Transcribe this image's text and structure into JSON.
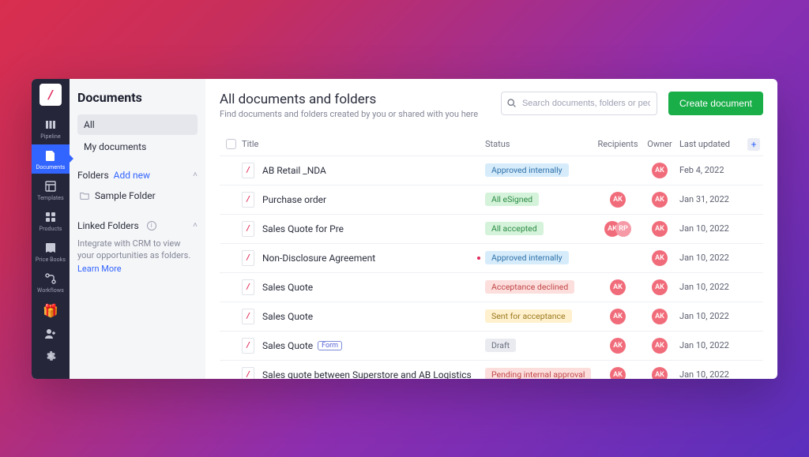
{
  "rail": {
    "items": [
      {
        "label": "Pipeline"
      },
      {
        "label": "Documents"
      },
      {
        "label": "Templates"
      },
      {
        "label": "Products"
      },
      {
        "label": "Price Books"
      },
      {
        "label": "Workflows"
      }
    ]
  },
  "sidebar": {
    "title": "Documents",
    "tabs": [
      {
        "label": "All"
      },
      {
        "label": "My documents"
      }
    ],
    "folders_label": "Folders",
    "add_new": "Add new",
    "folders": [
      {
        "name": "Sample Folder"
      }
    ],
    "linked_label": "Linked Folders",
    "linked_msg": "Integrate with CRM to view your opportunities as folders.",
    "learn_more": "Learn More"
  },
  "header": {
    "title": "All documents and folders",
    "subtitle": "Find documents and folders created by you or shared with you here",
    "search_placeholder": "Search documents, folders or people",
    "create_btn": "Create document"
  },
  "columns": {
    "title": "Title",
    "status": "Status",
    "recipients": "Recipients",
    "owner": "Owner",
    "last_updated": "Last updated"
  },
  "status_labels": {
    "approved": "Approved internally",
    "esigned": "All eSigned",
    "accepted": "All accepted",
    "declined": "Acceptance declined",
    "sent": "Sent for acceptance",
    "draft": "Draft",
    "pending": "Pending internal approval"
  },
  "rows": [
    {
      "title": "AB Retail _NDA",
      "status": "approved",
      "recipients": [],
      "owner": "AK",
      "updated": "Feb 4, 2022",
      "form": false,
      "dot": false
    },
    {
      "title": "Purchase order",
      "status": "esigned",
      "recipients": [
        "AK"
      ],
      "owner": "AK",
      "updated": "Jan 31, 2022",
      "form": false,
      "dot": false
    },
    {
      "title": "Sales Quote for Pre",
      "status": "accepted",
      "recipients": [
        "AK",
        "RP"
      ],
      "owner": "AK",
      "updated": "Jan 10, 2022",
      "form": false,
      "dot": false
    },
    {
      "title": "Non-Disclosure Agreement",
      "status": "approved",
      "recipients": [],
      "owner": "AK",
      "updated": "Jan 10, 2022",
      "form": false,
      "dot": true
    },
    {
      "title": "Sales Quote",
      "status": "declined",
      "recipients": [
        "AK"
      ],
      "owner": "AK",
      "updated": "Jan 10, 2022",
      "form": false,
      "dot": false
    },
    {
      "title": "Sales Quote",
      "status": "sent",
      "recipients": [
        "AK"
      ],
      "owner": "AK",
      "updated": "Jan 10, 2022",
      "form": false,
      "dot": false
    },
    {
      "title": "Sales Quote",
      "status": "draft",
      "recipients": [
        "AK"
      ],
      "owner": "AK",
      "updated": "Jan 10, 2022",
      "form": true,
      "dot": false
    },
    {
      "title": "Sales quote between Superstore and AB Logistics",
      "status": "pending",
      "recipients": [
        "AK"
      ],
      "owner": "AK",
      "updated": "Jan 10, 2022",
      "form": false,
      "dot": false
    }
  ],
  "form_tag": "Form"
}
